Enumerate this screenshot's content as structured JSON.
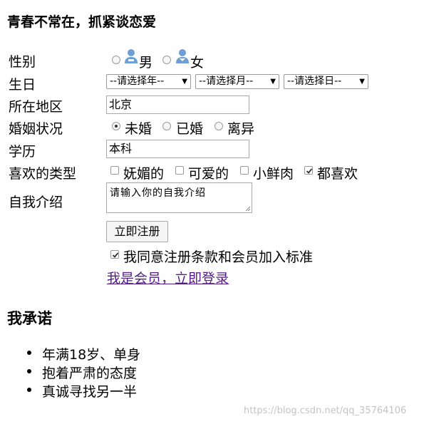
{
  "page_title": "青春不常在，抓紧谈恋爱",
  "form": {
    "gender": {
      "label": "性别",
      "options": [
        "男",
        "女"
      ]
    },
    "birthday": {
      "label": "生日",
      "year_placeholder": "--请选择年--",
      "month_placeholder": "--请选择月--",
      "day_placeholder": "--请选择日--"
    },
    "region": {
      "label": "所在地区",
      "value": "北京"
    },
    "marital": {
      "label": "婚姻状况",
      "options": [
        "未婚",
        "已婚",
        "离异"
      ],
      "selected": "未婚"
    },
    "education": {
      "label": "学历",
      "value": "本科"
    },
    "preferred_type": {
      "label": "喜欢的类型",
      "options": [
        "妩媚的",
        "可爱的",
        "小鲜肉",
        "都喜欢"
      ],
      "checked": [
        "都喜欢"
      ]
    },
    "intro": {
      "label": "自我介绍",
      "value": "请输入你的自我介绍"
    },
    "submit_label": "立即注册",
    "agree_label": "我同意注册条款和会员加入标准",
    "login_link": "我是会员，立即登录"
  },
  "promise": {
    "title": "我承诺",
    "items": [
      "年满18岁、单身",
      "抱着严肃的态度",
      "真诚寻找另一半"
    ]
  },
  "watermark": "https://blog.csdn.net/qq_35764106",
  "icons": {
    "male": "male-user-icon",
    "female": "female-user-icon"
  },
  "colors": {
    "link": "#551a8b",
    "icon_blue": "#6d9fd5"
  }
}
